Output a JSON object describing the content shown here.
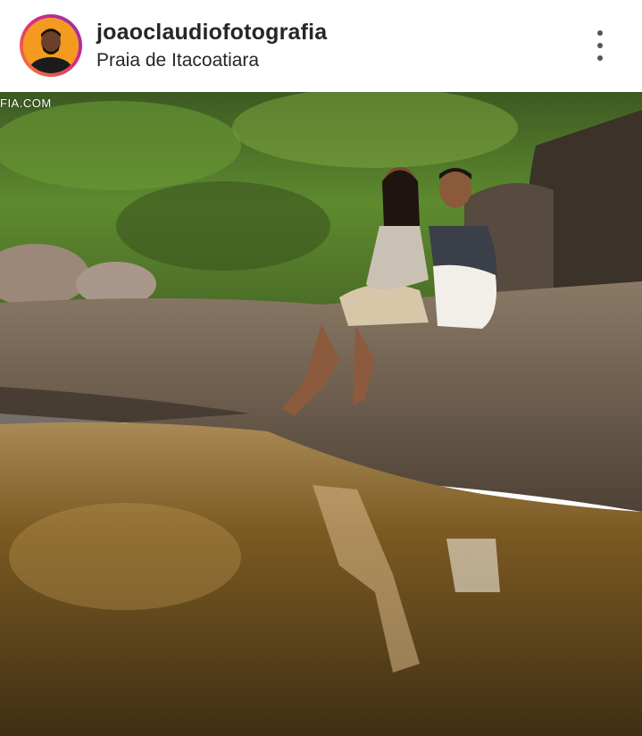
{
  "post_header": {
    "username": "joaoclaudiofotografia",
    "location": "Praia de Itacoatiara",
    "more_icon": "more-vertical-icon"
  },
  "photo": {
    "watermark_text": "FIA.COM",
    "colors": {
      "vegetation": "#4f7a2e",
      "rock": "#7a6a58",
      "water": "#8a6a30"
    }
  }
}
